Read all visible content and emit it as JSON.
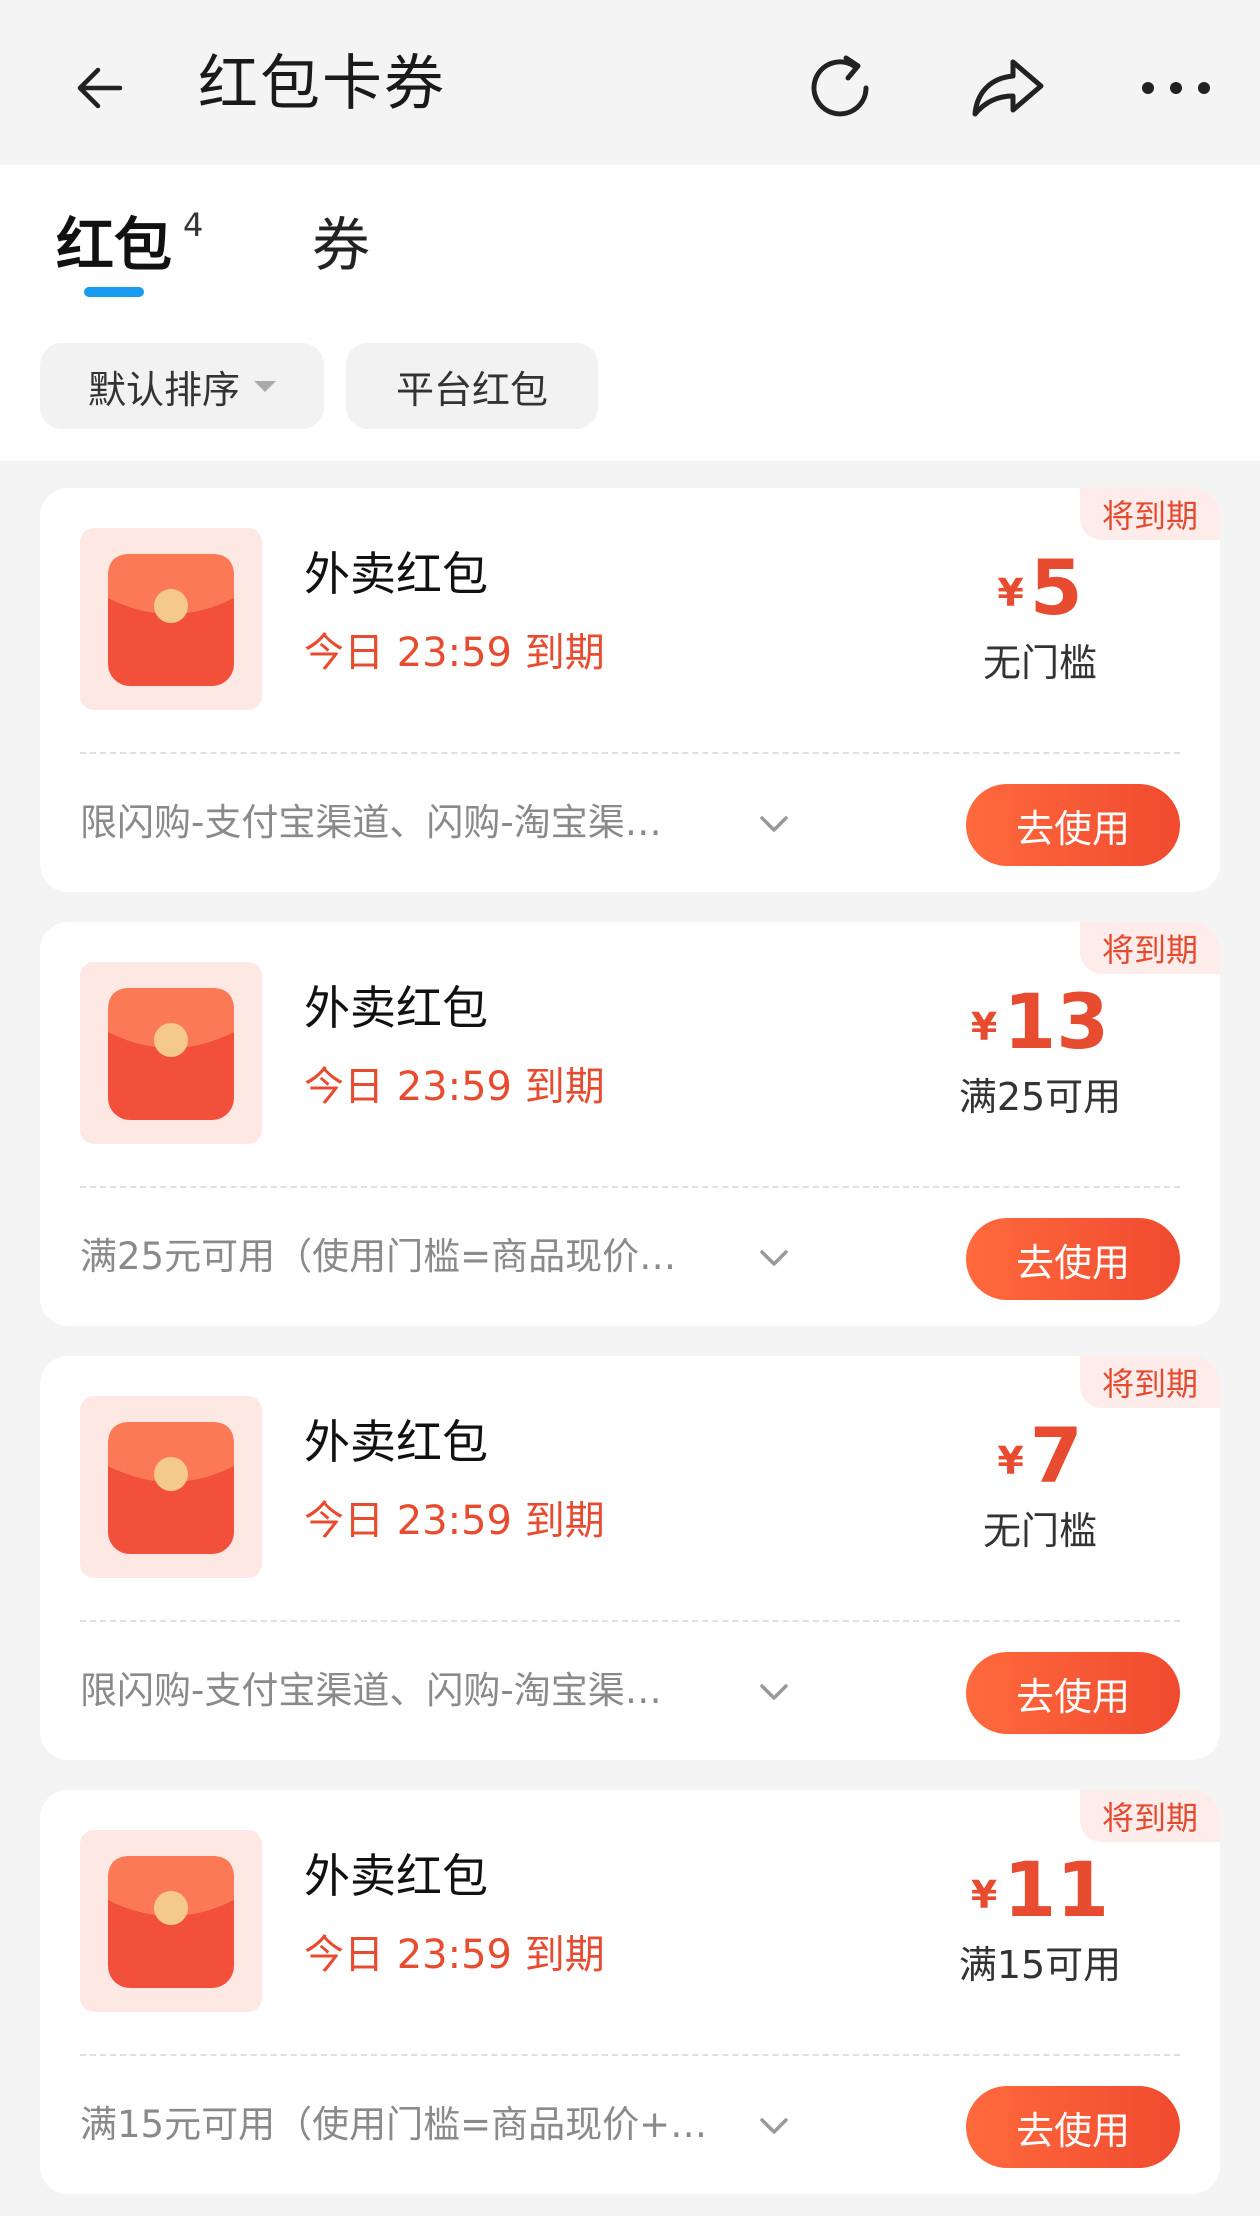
{
  "header": {
    "title": "红包卡券",
    "icons": [
      "back-arrow-icon",
      "refresh-icon",
      "share-icon",
      "more-icon"
    ]
  },
  "tabs": [
    {
      "label": "红包",
      "count": "4",
      "active": true
    },
    {
      "label": "券",
      "active": false
    }
  ],
  "filters": {
    "sort_label": "默认排序",
    "platform_label": "平台红包"
  },
  "colors": {
    "accent_red": "#e84c30",
    "tab_indicator": "#1a9af0",
    "button_gradient_start": "#ff6a3d",
    "button_gradient_end": "#f04a2f",
    "badge_bg": "#fdecea"
  },
  "coupons": [
    {
      "badge": "将到期",
      "title": "外卖红包",
      "expiry": "今日 23:59 到期",
      "currency": "¥",
      "amount": "5",
      "condition": "无门槛",
      "description": "限闪购-支付宝渠道、闪购-淘宝渠…",
      "button": "去使用"
    },
    {
      "badge": "将到期",
      "title": "外卖红包",
      "expiry": "今日 23:59 到期",
      "currency": "¥",
      "amount": "13",
      "condition": "满25可用",
      "description": "满25元可用（使用门槛=商品现价…",
      "button": "去使用"
    },
    {
      "badge": "将到期",
      "title": "外卖红包",
      "expiry": "今日 23:59 到期",
      "currency": "¥",
      "amount": "7",
      "condition": "无门槛",
      "description": "限闪购-支付宝渠道、闪购-淘宝渠…",
      "button": "去使用"
    },
    {
      "badge": "将到期",
      "title": "外卖红包",
      "expiry": "今日 23:59 到期",
      "currency": "¥",
      "amount": "11",
      "condition": "满15可用",
      "description": "满15元可用（使用门槛=商品现价+…",
      "button": "去使用"
    }
  ]
}
